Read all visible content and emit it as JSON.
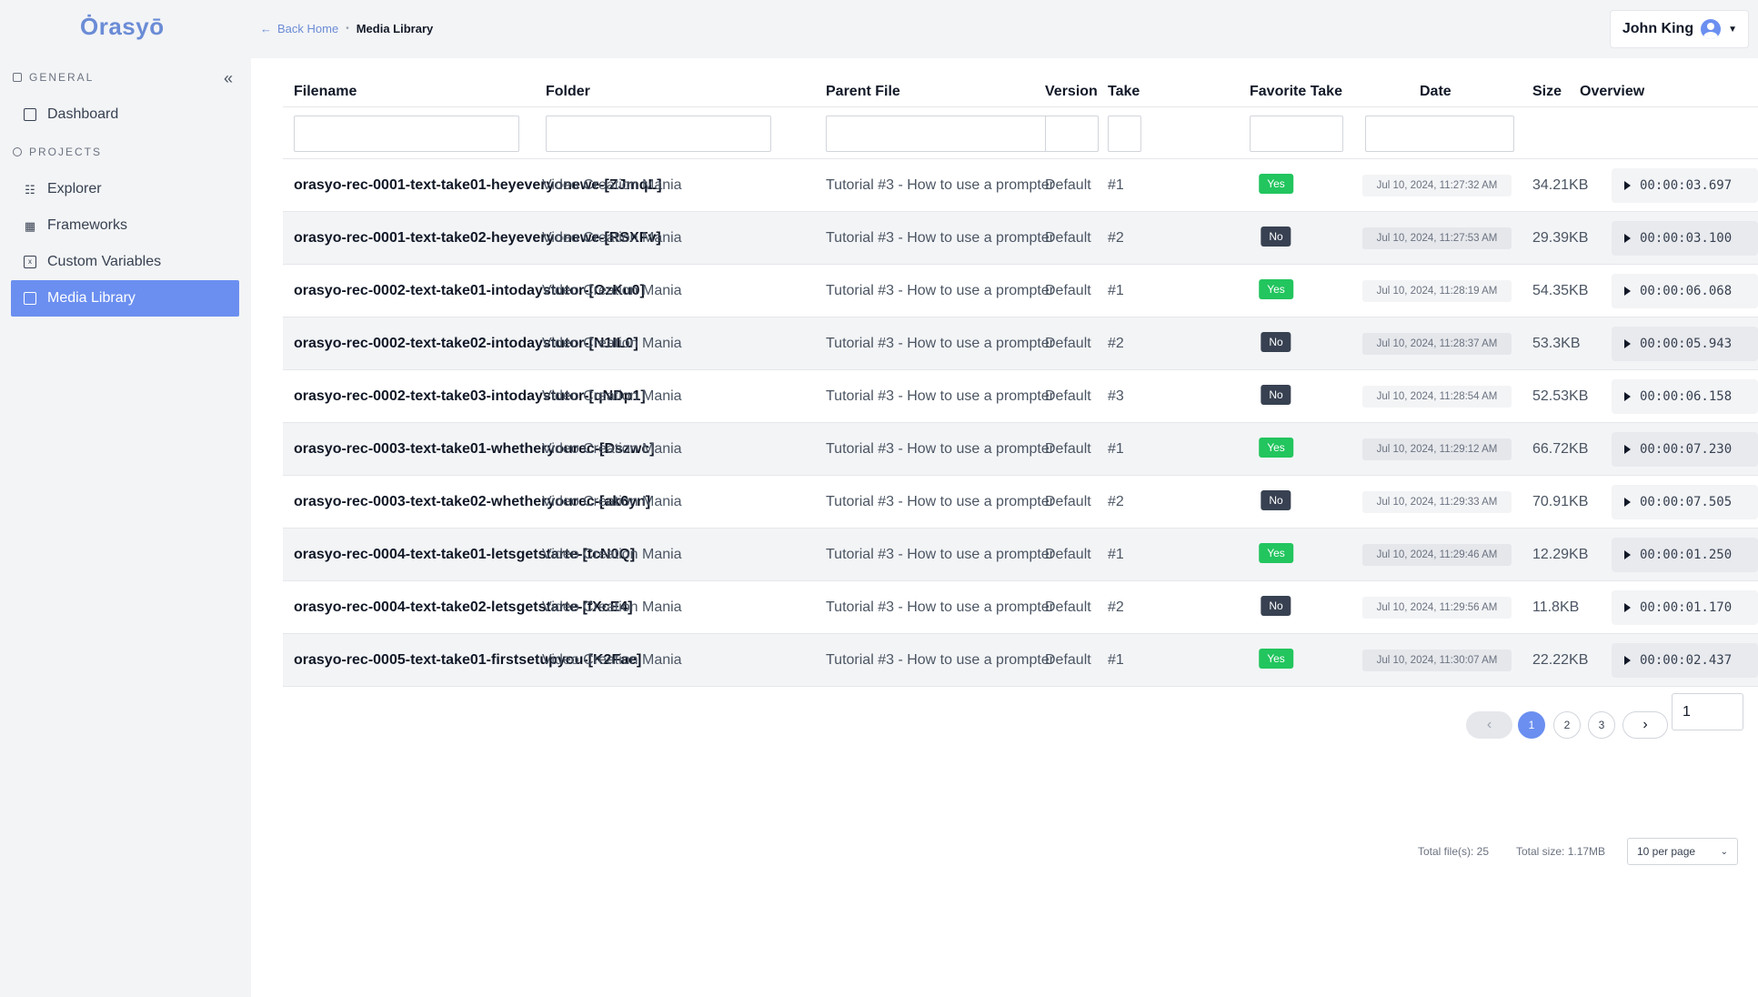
{
  "app": {
    "logo": "Ȯrasyō"
  },
  "sidebar": {
    "general_label": "GENERAL",
    "projects_label": "PROJECTS",
    "collapse_glyph": "«",
    "items": [
      {
        "label": "Dashboard",
        "icon": "dashboard-icon",
        "active": false
      },
      {
        "label": "Explorer",
        "icon": "explorer-icon",
        "active": false
      },
      {
        "label": "Frameworks",
        "icon": "grid-icon",
        "active": false
      },
      {
        "label": "Custom Variables",
        "icon": "variables-icon",
        "active": false
      },
      {
        "label": "Media Library",
        "icon": "media-library-icon",
        "active": true
      }
    ]
  },
  "header": {
    "back_label": "Back Home",
    "current_page": "Media Library",
    "user_name": "John King"
  },
  "table": {
    "columns": [
      "Filename",
      "Folder",
      "Parent File",
      "Version",
      "Take",
      "Favorite Take",
      "Date",
      "Size",
      "Overview"
    ],
    "rows": [
      {
        "filename": "orasyo-rec-0001-text-take01-heyeveryonewe-[ZJmqL]",
        "folder": "Video Creation Mania",
        "parent": "Tutorial #3 - How to use a prompter",
        "version": "Default",
        "take": "#1",
        "favorite": "Yes",
        "date": "Jul 10, 2024, 11:27:32 AM",
        "size": "34.21KB",
        "duration": "00:00:03.697"
      },
      {
        "filename": "orasyo-rec-0001-text-take02-heyeveryonewe-[RSXFv]",
        "folder": "Video Creation Mania",
        "parent": "Tutorial #3 - How to use a prompter",
        "version": "Default",
        "take": "#2",
        "favorite": "No",
        "date": "Jul 10, 2024, 11:27:53 AM",
        "size": "29.39KB",
        "duration": "00:00:03.100"
      },
      {
        "filename": "orasyo-rec-0002-text-take01-intodaystutor-[OzKu0]",
        "folder": "Video Creation Mania",
        "parent": "Tutorial #3 - How to use a prompter",
        "version": "Default",
        "take": "#1",
        "favorite": "Yes",
        "date": "Jul 10, 2024, 11:28:19 AM",
        "size": "54.35KB",
        "duration": "00:00:06.068"
      },
      {
        "filename": "orasyo-rec-0002-text-take02-intodaystutor-[N1IL0]",
        "folder": "Video Creation Mania",
        "parent": "Tutorial #3 - How to use a prompter",
        "version": "Default",
        "take": "#2",
        "favorite": "No",
        "date": "Jul 10, 2024, 11:28:37 AM",
        "size": "53.3KB",
        "duration": "00:00:05.943"
      },
      {
        "filename": "orasyo-rec-0002-text-take03-intodaystutor-[qNDp1]",
        "folder": "Video Creation Mania",
        "parent": "Tutorial #3 - How to use a prompter",
        "version": "Default",
        "take": "#3",
        "favorite": "No",
        "date": "Jul 10, 2024, 11:28:54 AM",
        "size": "52.53KB",
        "duration": "00:00:06.158"
      },
      {
        "filename": "orasyo-rec-0003-text-take01-whetheryourec-[Dszwc]",
        "folder": "Video Creation Mania",
        "parent": "Tutorial #3 - How to use a prompter",
        "version": "Default",
        "take": "#1",
        "favorite": "Yes",
        "date": "Jul 10, 2024, 11:29:12 AM",
        "size": "66.72KB",
        "duration": "00:00:07.230"
      },
      {
        "filename": "orasyo-rec-0003-text-take02-whetheryourec-[ak6yn]",
        "folder": "Video Creation Mania",
        "parent": "Tutorial #3 - How to use a prompter",
        "version": "Default",
        "take": "#2",
        "favorite": "No",
        "date": "Jul 10, 2024, 11:29:33 AM",
        "size": "70.91KB",
        "duration": "00:00:07.505"
      },
      {
        "filename": "orasyo-rec-0004-text-take01-letsgetstarte-[tcN0Q]",
        "folder": "Video Creation Mania",
        "parent": "Tutorial #3 - How to use a prompter",
        "version": "Default",
        "take": "#1",
        "favorite": "Yes",
        "date": "Jul 10, 2024, 11:29:46 AM",
        "size": "12.29KB",
        "duration": "00:00:01.250"
      },
      {
        "filename": "orasyo-rec-0004-text-take02-letsgetstarte-[fXcE4]",
        "folder": "Video Creation Mania",
        "parent": "Tutorial #3 - How to use a prompter",
        "version": "Default",
        "take": "#2",
        "favorite": "No",
        "date": "Jul 10, 2024, 11:29:56 AM",
        "size": "11.8KB",
        "duration": "00:00:01.170"
      },
      {
        "filename": "orasyo-rec-0005-text-take01-firstsetupyou-[K2Fae]",
        "folder": "Video Creation Mania",
        "parent": "Tutorial #3 - How to use a prompter",
        "version": "Default",
        "take": "#1",
        "favorite": "Yes",
        "date": "Jul 10, 2024, 11:30:07 AM",
        "size": "22.22KB",
        "duration": "00:00:02.437"
      }
    ]
  },
  "pagination": {
    "pages": [
      "1",
      "2",
      "3"
    ],
    "current": "1",
    "page_input_value": "1"
  },
  "footer": {
    "total_files": "Total file(s): 25",
    "total_size": "Total size: 1.17MB",
    "per_page": "10 per page"
  },
  "colors": {
    "accent": "#6b8ff0",
    "yes_badge": "#22c55e",
    "no_badge": "#374151"
  }
}
